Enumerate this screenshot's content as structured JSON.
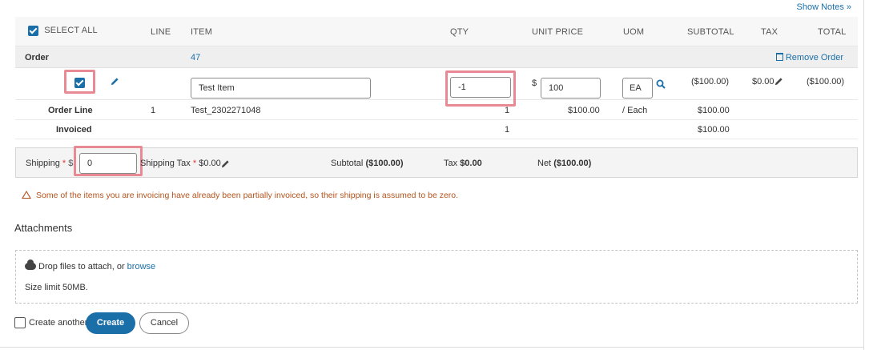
{
  "show_notes": "Show Notes »",
  "header": {
    "select_all": "SELECT ALL",
    "line": "LINE",
    "item": "ITEM",
    "qty": "QTY",
    "unit_price": "UNIT PRICE",
    "uom": "UOM",
    "subtotal": "SUBTOTAL",
    "tax": "TAX",
    "total": "TOTAL"
  },
  "order": {
    "label": "Order",
    "number": "47",
    "remove_label": "Remove Order"
  },
  "edit_row": {
    "item_value": "Test Item",
    "qty_value": "-1",
    "currency_symbol": "$",
    "unit_price_value": "100",
    "uom_value": "EA",
    "subtotal": "($100.00)",
    "tax": "$0.00",
    "total": "($100.00)"
  },
  "order_line": {
    "label": "Order Line",
    "line": "1",
    "item": "Test_2302271048",
    "qty": "1",
    "unit_price": "$100.00",
    "uom": "/ Each",
    "subtotal": "$100.00"
  },
  "invoiced": {
    "label": "Invoiced",
    "qty": "1",
    "subtotal": "$100.00"
  },
  "shipping": {
    "label": "Shipping",
    "required_mark": "*",
    "currency_symbol": "$",
    "value": "0",
    "tax_label": "Shipping Tax",
    "tax_value": "$0.00",
    "subtotal_label": "Subtotal",
    "subtotal_value": "($100.00)",
    "tax_total_label": "Tax",
    "tax_total_value": "$0.00",
    "net_label": "Net",
    "net_value": "($100.00)"
  },
  "warning": "Some of the items you are invoicing have already been partially invoiced, so their shipping is assumed to be zero.",
  "attachments": {
    "title": "Attachments",
    "drop_text": "Drop files to attach, or",
    "browse_link": "browse",
    "size_limit": "Size limit 50MB."
  },
  "footer": {
    "create_another": "Create another",
    "create_button": "Create",
    "cancel_button": "Cancel"
  },
  "colors": {
    "accent": "#1a6fa8",
    "highlight": "#e88a94",
    "warning": "#b3531d",
    "required": "#d9342b"
  },
  "icons": [
    "pencil-icon",
    "search-icon",
    "trash-icon",
    "warning-icon",
    "cloud-upload-icon",
    "checkbox-checked-icon"
  ]
}
